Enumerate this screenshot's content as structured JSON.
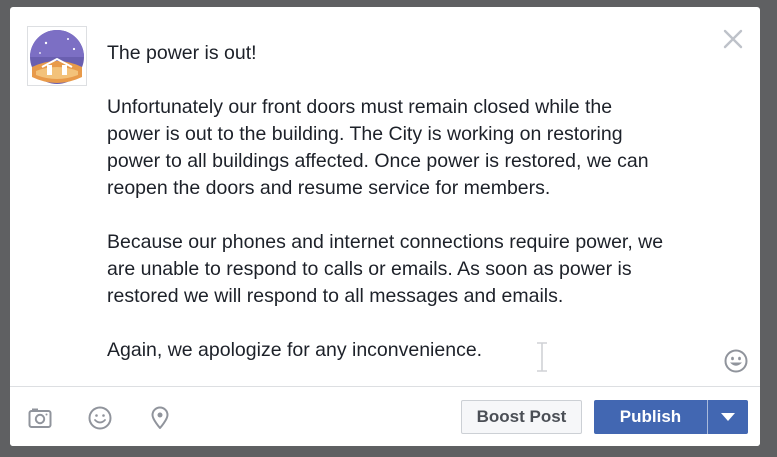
{
  "post": {
    "paragraphs": [
      "The power is out!",
      "Unfortunately our front doors must remain closed while the\npower is out to the building. The City is working on restoring\npower to all buildings affected. Once power is restored, we can\nreopen the doors and resume service for members.",
      "Because our phones and internet connections require power, we\nare unable to respond to calls or emails. As soon as power is\nrestored we will respond to all messages and emails.",
      "Again, we apologize for any inconvenience."
    ]
  },
  "footer": {
    "boost_label": "Boost Post",
    "publish_label": "Publish"
  },
  "colors": {
    "publish_blue": "#4267b2",
    "text": "#1d2129",
    "icon_gray": "#90949c"
  },
  "icons": {
    "close": "close-icon",
    "emoji": "emoji-icon",
    "photo": "camera-icon",
    "feeling": "smiley-icon",
    "location": "location-pin-icon",
    "dropdown": "caret-down-icon"
  }
}
